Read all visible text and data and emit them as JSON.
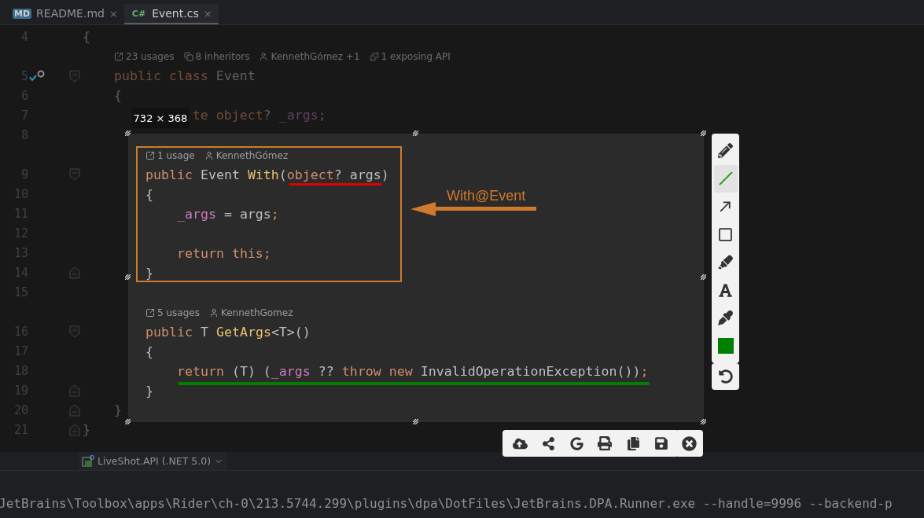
{
  "tabs": [
    {
      "label": "README.md",
      "badge": "MD",
      "close": "×",
      "selected": false
    },
    {
      "label": "Event.cs",
      "badge": "C#",
      "close": "×",
      "selected": true
    }
  ],
  "editor": {
    "rows": [
      {
        "kind": "code",
        "number": "4",
        "implemented": false,
        "block_start": false,
        "block_end": false,
        "tokens": [
          {
            "text": "{",
            "kind": "plain"
          }
        ]
      },
      {
        "kind": "hints",
        "hints": [
          {
            "kind": "usages",
            "label": "23 usages"
          },
          {
            "kind": "inheritors",
            "label": "8 inheritors"
          },
          {
            "kind": "author",
            "label": "KennethGómez +1"
          },
          {
            "kind": "api",
            "label": "1 exposing API"
          }
        ]
      },
      {
        "kind": "code",
        "number": "5",
        "implemented": true,
        "block_start": true,
        "block_end": false,
        "tokens": [
          {
            "text": "    public class",
            "kind": "keyword"
          },
          {
            "text": " Event",
            "kind": "plain"
          }
        ]
      },
      {
        "kind": "code",
        "number": "6",
        "implemented": false,
        "block_start": false,
        "block_end": false,
        "tokens": [
          {
            "text": "    {",
            "kind": "plain"
          }
        ]
      },
      {
        "kind": "code",
        "number": "7",
        "implemented": false,
        "block_start": false,
        "block_end": false,
        "tokens": [
          {
            "text": "              te object",
            "kind": "keyword"
          },
          {
            "text": "? ",
            "kind": "plain"
          },
          {
            "text": "_args",
            "kind": "field"
          },
          {
            "text": ";",
            "kind": "punct"
          }
        ]
      },
      {
        "kind": "code",
        "number": "8",
        "implemented": false,
        "block_start": false,
        "block_end": false
      },
      {
        "kind": "spacer"
      },
      {
        "kind": "code",
        "number": "9",
        "implemented": false,
        "block_start": true,
        "block_end": false
      },
      {
        "kind": "code",
        "number": "10",
        "implemented": false,
        "block_start": false,
        "block_end": false
      },
      {
        "kind": "code",
        "number": "11",
        "implemented": false,
        "block_start": false,
        "block_end": false
      },
      {
        "kind": "code",
        "number": "12",
        "implemented": false,
        "block_start": false,
        "block_end": false
      },
      {
        "kind": "code",
        "number": "13",
        "implemented": false,
        "block_start": false,
        "block_end": false
      },
      {
        "kind": "code",
        "number": "14",
        "implemented": false,
        "block_start": false,
        "block_end": true
      },
      {
        "kind": "code",
        "number": "15",
        "implemented": false,
        "block_start": false,
        "block_end": false
      },
      {
        "kind": "spacer"
      },
      {
        "kind": "code",
        "number": "16",
        "implemented": false,
        "block_start": true,
        "block_end": false
      },
      {
        "kind": "code",
        "number": "17",
        "implemented": false,
        "block_start": false,
        "block_end": false
      },
      {
        "kind": "code",
        "number": "18",
        "implemented": false,
        "block_start": false,
        "block_end": false
      },
      {
        "kind": "code",
        "number": "19",
        "implemented": false,
        "block_start": false,
        "block_end": true
      },
      {
        "kind": "code",
        "number": "20",
        "implemented": false,
        "block_start": false,
        "block_end": true,
        "tokens": [
          {
            "text": "    }",
            "kind": "plain"
          }
        ]
      },
      {
        "kind": "code",
        "number": "21",
        "implemented": false,
        "block_start": false,
        "block_end": true,
        "tokens": [
          {
            "text": "}",
            "kind": "plain"
          }
        ]
      }
    ]
  },
  "capture": {
    "size_label": "732 × 368",
    "rows": [
      {
        "kind": "hints",
        "hints": [
          {
            "kind": "usages",
            "label": "1 usage"
          },
          {
            "kind": "author",
            "label": "KennethGómez"
          }
        ]
      },
      {
        "kind": "code",
        "tokens": [
          {
            "text": "public",
            "kind": "keyword"
          },
          {
            "text": " Event ",
            "kind": "plain"
          },
          {
            "text": "With",
            "kind": "method"
          },
          {
            "text": "(",
            "kind": "plain"
          },
          {
            "text": "object",
            "kind": "keyword"
          },
          {
            "text": "? args)",
            "kind": "plain"
          }
        ]
      },
      {
        "kind": "code",
        "tokens": [
          {
            "text": "{",
            "kind": "plain"
          }
        ]
      },
      {
        "kind": "code",
        "tokens": [
          {
            "text": "    _args",
            "kind": "field"
          },
          {
            "text": " = args",
            "kind": "plain"
          },
          {
            "text": ";",
            "kind": "punct"
          }
        ]
      },
      {
        "kind": "spacer"
      },
      {
        "kind": "code",
        "tokens": [
          {
            "text": "    return this",
            "kind": "keyword"
          },
          {
            "text": ";",
            "kind": "punct"
          }
        ]
      },
      {
        "kind": "code",
        "tokens": [
          {
            "text": "}",
            "kind": "plain"
          }
        ]
      },
      {
        "kind": "spacer"
      },
      {
        "kind": "hints",
        "hints": [
          {
            "kind": "usages",
            "label": "5 usages"
          },
          {
            "kind": "author",
            "label": "KennethGomez"
          }
        ]
      },
      {
        "kind": "code",
        "tokens": [
          {
            "text": "public",
            "kind": "keyword"
          },
          {
            "text": " T ",
            "kind": "plain"
          },
          {
            "text": "GetArgs",
            "kind": "method"
          },
          {
            "text": "<T>()",
            "kind": "plain"
          }
        ]
      },
      {
        "kind": "code",
        "tokens": [
          {
            "text": "{",
            "kind": "plain"
          }
        ]
      },
      {
        "kind": "code",
        "tokens": [
          {
            "text": "    return",
            "kind": "keyword"
          },
          {
            "text": " (T) (",
            "kind": "plain"
          },
          {
            "text": "_args",
            "kind": "field"
          },
          {
            "text": " ?? ",
            "kind": "plain"
          },
          {
            "text": "throw new",
            "kind": "keyword"
          },
          {
            "text": " InvalidOperationException())",
            "kind": "plain"
          },
          {
            "text": ";",
            "kind": "punct"
          }
        ]
      },
      {
        "kind": "code",
        "tokens": [
          {
            "text": "}",
            "kind": "plain"
          }
        ]
      }
    ],
    "annotations": [
      {
        "kind": "rect",
        "color": "#d07a2e"
      },
      {
        "kind": "underline",
        "color": "#e00000"
      },
      {
        "kind": "arrow",
        "color": "#d07a2e"
      },
      {
        "kind": "text",
        "color": "#d07a2e",
        "text": "With@Event"
      },
      {
        "kind": "underline",
        "color": "#008000"
      }
    ]
  },
  "tools": [
    {
      "kind": "pencil",
      "selected": false
    },
    {
      "kind": "line",
      "selected": true
    },
    {
      "kind": "arrow",
      "selected": false
    },
    {
      "kind": "rectangle",
      "selected": false
    },
    {
      "kind": "highlighter",
      "selected": false
    },
    {
      "kind": "text",
      "selected": false
    },
    {
      "kind": "eyedropper",
      "selected": false
    },
    {
      "kind": "color",
      "color": "#008000",
      "selected": false
    }
  ],
  "actions": [
    {
      "kind": "upload"
    },
    {
      "kind": "share"
    },
    {
      "kind": "google"
    },
    {
      "kind": "print"
    },
    {
      "kind": "copy"
    },
    {
      "kind": "save"
    }
  ],
  "breadcrumb": "LiveShot.API (.NET 5.0)",
  "terminal": "JetBrains\\Toolbox\\apps\\Rider\\ch-0\\213.5744.299\\plugins\\dpa\\DotFiles\\JetBrains.DPA.Runner.exe --handle=9996 --backend-p"
}
